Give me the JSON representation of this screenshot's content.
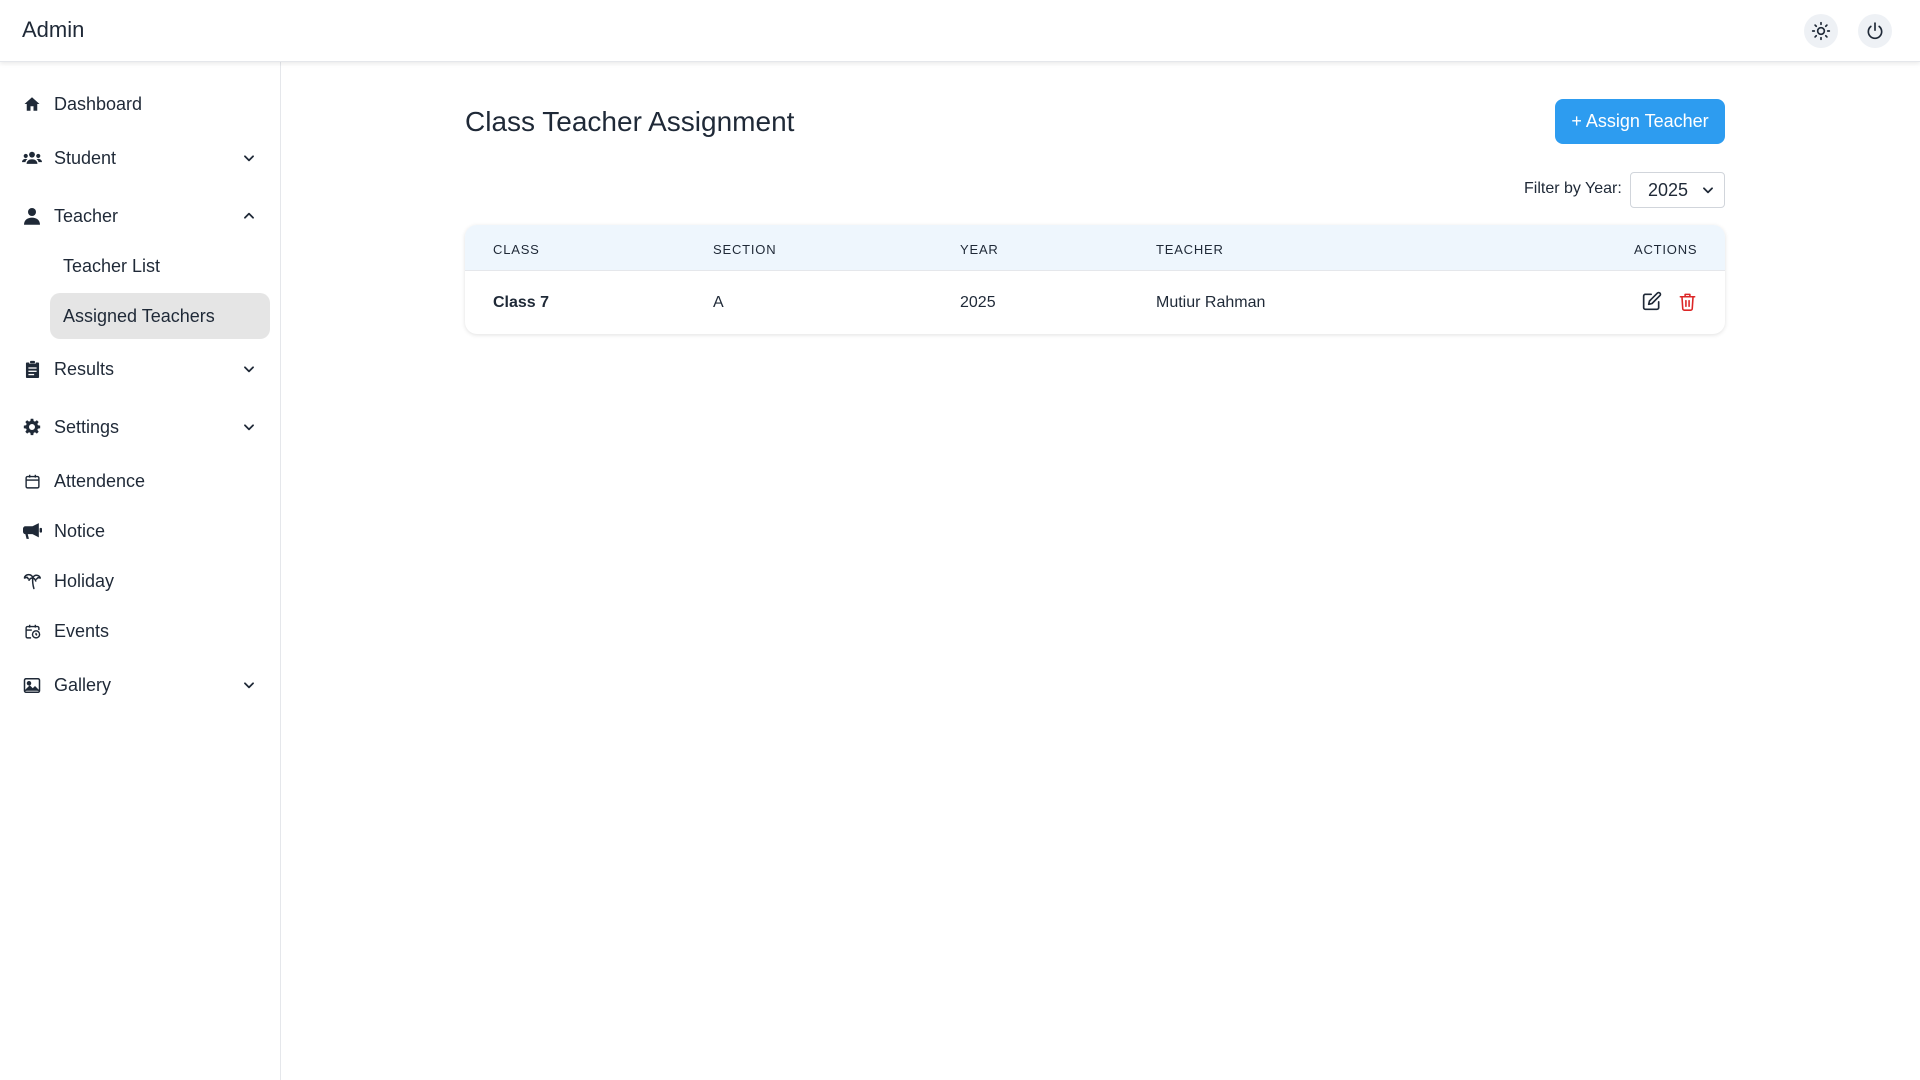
{
  "header": {
    "title": "Admin",
    "theme_icon": "sun-icon",
    "power_icon": "power-icon"
  },
  "sidebar": {
    "items": [
      {
        "label": "Dashboard",
        "icon": "home-icon",
        "expandable": false
      },
      {
        "label": "Student",
        "icon": "users-icon",
        "expandable": true,
        "expanded": false
      },
      {
        "label": "Teacher",
        "icon": "user-icon",
        "expandable": true,
        "expanded": true,
        "children": [
          {
            "label": "Teacher List",
            "active": false
          },
          {
            "label": "Assigned Teachers",
            "active": true
          }
        ]
      },
      {
        "label": "Results",
        "icon": "clipboard-icon",
        "expandable": true,
        "expanded": false
      },
      {
        "label": "Settings",
        "icon": "gear-icon",
        "expandable": true,
        "expanded": false
      },
      {
        "label": "Attendence",
        "icon": "calendar-icon",
        "expandable": false
      },
      {
        "label": "Notice",
        "icon": "megaphone-icon",
        "expandable": false
      },
      {
        "label": "Holiday",
        "icon": "palm-tree-icon",
        "expandable": false
      },
      {
        "label": "Events",
        "icon": "calendar-clock-icon",
        "expandable": false
      },
      {
        "label": "Gallery",
        "icon": "image-icon",
        "expandable": true,
        "expanded": false
      }
    ]
  },
  "main": {
    "title": "Class Teacher Assignment",
    "assign_button": "+ Assign Teacher",
    "filter": {
      "label": "Filter by Year:",
      "selected": "2025"
    },
    "table": {
      "columns": [
        "CLASS",
        "SECTION",
        "YEAR",
        "TEACHER",
        "ACTIONS"
      ],
      "rows": [
        {
          "class": "Class 7",
          "section": "A",
          "year": "2025",
          "teacher": "Mutiur Rahman"
        }
      ]
    }
  },
  "colors": {
    "accent": "#2d9cf0",
    "active_nav_bg": "#e5e5e5",
    "table_header_bg": "#eef6fd",
    "delete": "#dc2626"
  }
}
